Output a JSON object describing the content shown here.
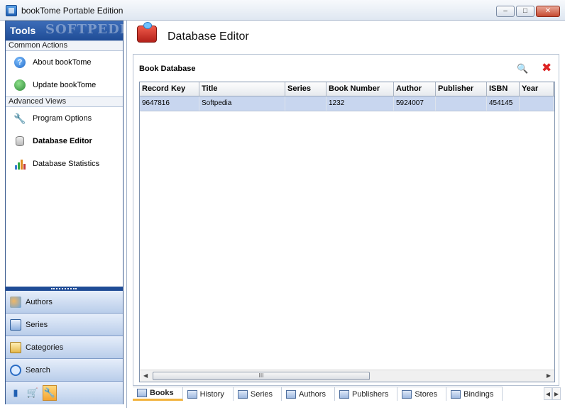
{
  "window": {
    "title": "bookTome Portable Edition",
    "minimize": "–",
    "maximize": "□",
    "close": "✕"
  },
  "left_panel": {
    "header": "Tools",
    "watermark": "SOFTPEDIA",
    "common_actions_label": "Common Actions",
    "common_actions": [
      {
        "label": "About bookTome",
        "icon": "help-icon"
      },
      {
        "label": "Update bookTome",
        "icon": "globe-icon"
      }
    ],
    "advanced_views_label": "Advanced Views",
    "advanced_views": [
      {
        "label": "Program Options",
        "icon": "wrench-icon"
      },
      {
        "label": "Database Editor",
        "icon": "database-icon",
        "active": true
      },
      {
        "label": "Database Statistics",
        "icon": "bar-chart-icon"
      }
    ],
    "bottom_nav": [
      {
        "label": "Authors",
        "icon": "authors-icon"
      },
      {
        "label": "Series",
        "icon": "series-icon"
      },
      {
        "label": "Categories",
        "icon": "categories-icon"
      },
      {
        "label": "Search",
        "icon": "search-icon"
      }
    ],
    "bottom_icons": [
      "book-icon",
      "cart-icon",
      "tools-icon"
    ]
  },
  "main": {
    "title": "Database Editor",
    "group_title": "Book Database",
    "toolbar": {
      "find_icon": "binoculars-icon",
      "delete_icon": "delete-icon"
    },
    "grid": {
      "columns": [
        "Record Key",
        "Title",
        "Series",
        "Book Number",
        "Author",
        "Publisher",
        "ISBN",
        "Year"
      ],
      "rows": [
        [
          "9647816",
          "Softpedia",
          "",
          "1232",
          "5924007",
          "",
          "454145",
          ""
        ]
      ],
      "scroll_thumb": "III"
    },
    "tabs": [
      "Books",
      "History",
      "Series",
      "Authors",
      "Publishers",
      "Stores",
      "Bindings"
    ],
    "active_tab": "Books"
  },
  "colors": {
    "header_blue": "#1f4c96",
    "row_selected": "#c8d6ef",
    "tab_accent": "#f2b33d",
    "delete_red": "#d22222"
  }
}
